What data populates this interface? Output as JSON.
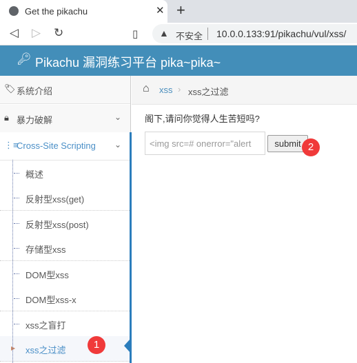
{
  "browser": {
    "tab_title": "Get the pikachu",
    "insecure_label": "不安全",
    "url": "10.0.0.133:91/pikachu/vul/xss/"
  },
  "header": {
    "brand": "Pikachu 漏洞练习平台 pika~pika~"
  },
  "sidebar": {
    "items": [
      {
        "label": "系统介绍"
      },
      {
        "label": "暴力破解"
      },
      {
        "label": "Cross-Site Scripting"
      }
    ],
    "subitems": [
      {
        "label": "概述"
      },
      {
        "label": "反射型xss(get)"
      },
      {
        "label": "反射型xss(post)"
      },
      {
        "label": "存储型xss"
      },
      {
        "label": "DOM型xss"
      },
      {
        "label": "DOM型xss-x"
      },
      {
        "label": "xss之盲打"
      },
      {
        "label": "xss之过滤"
      }
    ]
  },
  "breadcrumb": {
    "parent": "xss",
    "current": "xss之过滤"
  },
  "main": {
    "question": "阁下,请问你觉得人生苦短吗?",
    "input_value": "<img src=# onerror=\"alert",
    "submit_label": "submit"
  },
  "annotations": {
    "badge1": "1",
    "badge2": "2"
  }
}
